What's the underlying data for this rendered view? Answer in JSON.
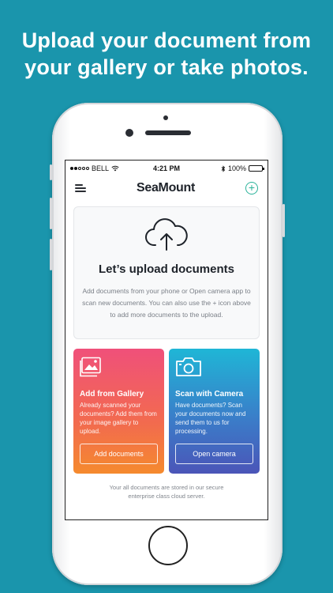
{
  "headline": {
    "line1": "Upload your document from",
    "line2": "your gallery or take photos."
  },
  "statusbar": {
    "carrier": "BELL",
    "time": "4:21 PM",
    "battery": "100%",
    "battery_level": 1.0
  },
  "navbar": {
    "title": "SeaMount",
    "menu_icon": "hamburger-icon",
    "add_icon": "plus-circle-icon",
    "add_symbol": "+"
  },
  "upload": {
    "icon": "cloud-upload-icon",
    "title": "Let’s upload documents",
    "description": "Add documents from your phone or Open camera app to scan new documents. You can also use the + icon above to add more documents to the upload."
  },
  "gallery": {
    "icon": "image-gallery-icon",
    "title": "Add from Gallery",
    "description": "Already scanned your documents? Add them from your image gallery to upload.",
    "button": "Add documents"
  },
  "camera": {
    "icon": "camera-icon",
    "title": "Scan with Camera",
    "description": "Have documents? Scan your documents now and send them to us for processing.",
    "button": "Open camera"
  },
  "footer": {
    "note": "Your all documents are stored in our secure enterprise class cloud server."
  },
  "colors": {
    "background": "#1a95ac",
    "accent": "#2bb39a",
    "gallery_gradient": [
      "#f0507a",
      "#f58a2e"
    ],
    "camera_gradient": [
      "#1fb6d6",
      "#4b55b8"
    ]
  }
}
